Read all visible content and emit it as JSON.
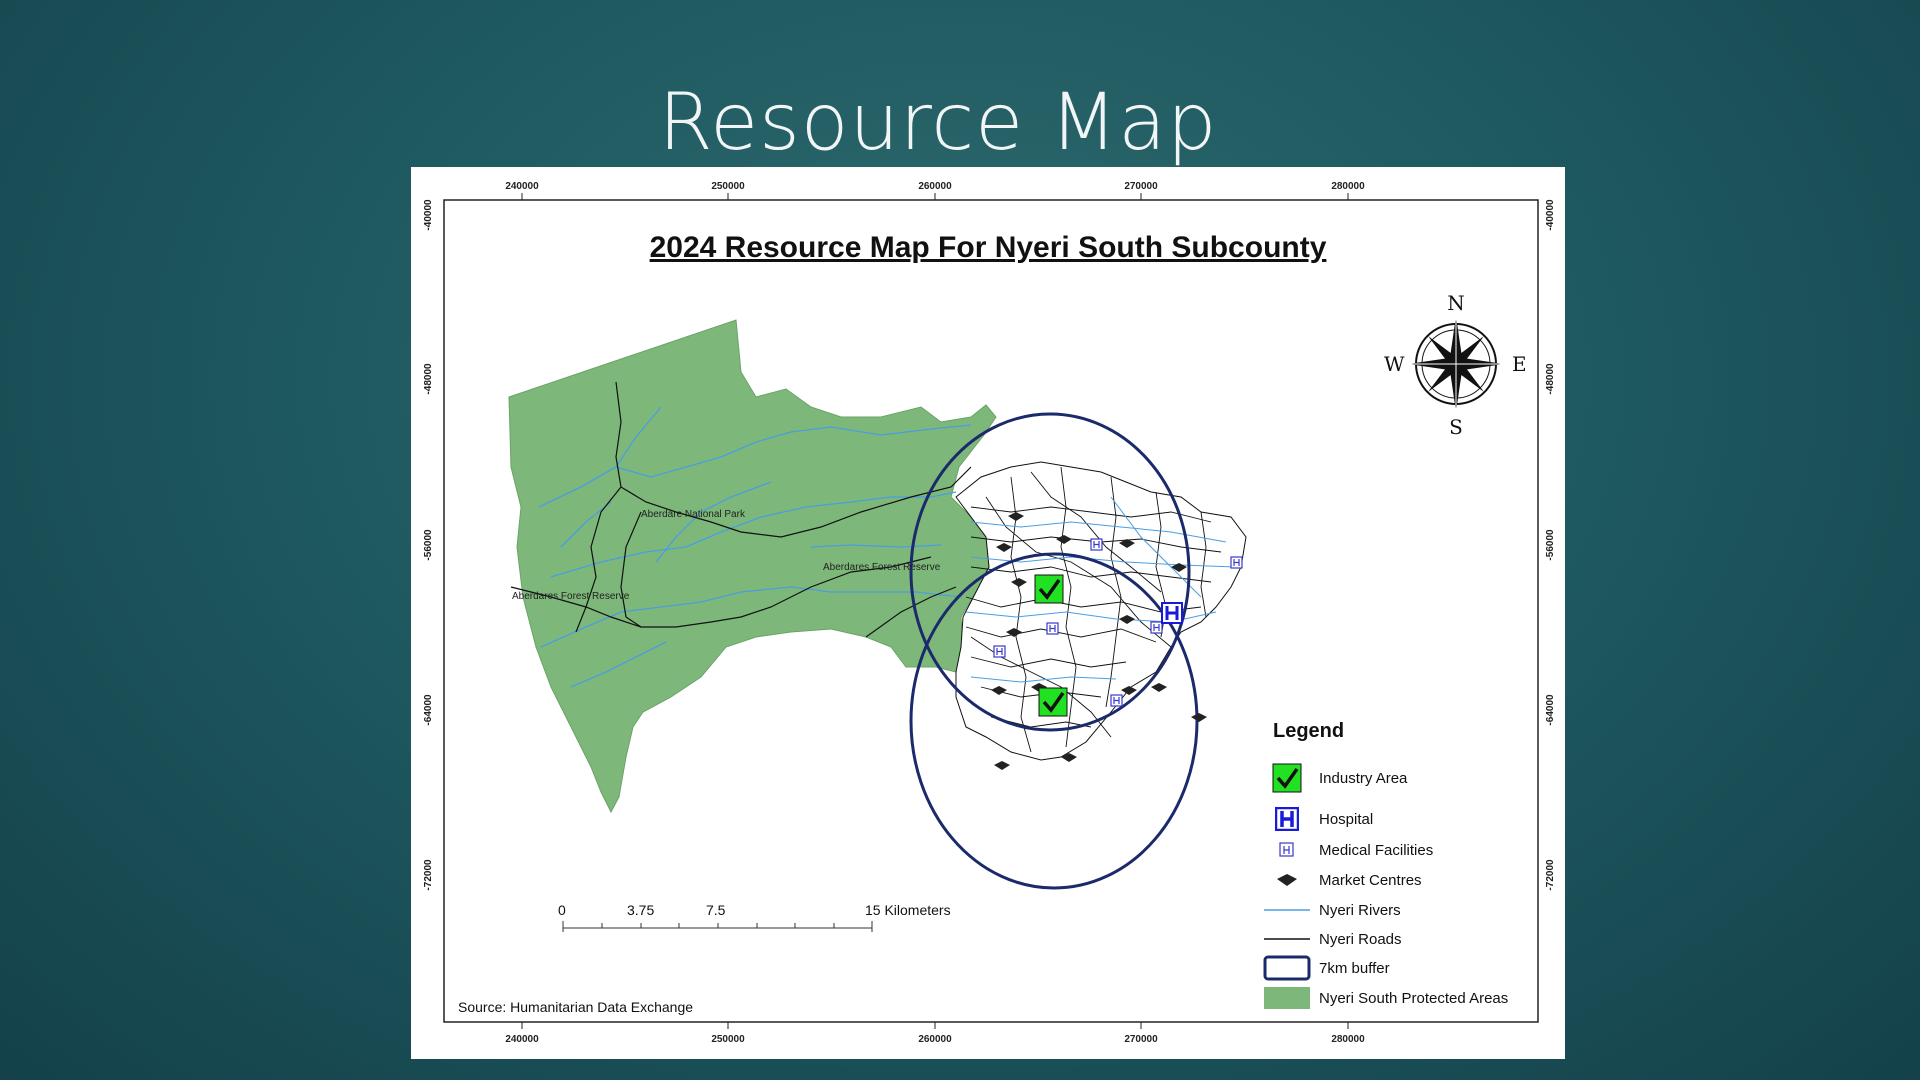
{
  "slide": {
    "title": "Resource Map"
  },
  "map": {
    "title": "2024 Resource Map For Nyeri South Subcounty",
    "x_ticks": [
      "240000",
      "250000",
      "260000",
      "270000",
      "280000"
    ],
    "y_ticks": [
      "-40000",
      "-48000",
      "-56000",
      "-64000",
      "-72000"
    ],
    "place_labels": {
      "national_park": "Aberdare National Park",
      "forest_east": "Aberdares Forest Reserve",
      "forest_west": "Aberdares Forest Reserve"
    },
    "compass": {
      "n": "N",
      "s": "S",
      "e": "E",
      "w": "W"
    },
    "scale_bar": {
      "l0": "0",
      "l1": "3.75",
      "l2": "7.5",
      "l3": "15 Kilometers"
    },
    "source": "Source: Humanitarian Data Exchange",
    "legend": {
      "title": "Legend",
      "items": [
        {
          "label": "Industry Area",
          "icon": "industry-check-icon",
          "color": "#22e022"
        },
        {
          "label": "Hospital",
          "icon": "hospital-icon",
          "color": "#1a1adb"
        },
        {
          "label": "Medical Facilities",
          "icon": "medical-facility-icon",
          "color": "#3a3acc"
        },
        {
          "label": "Market Centres",
          "icon": "market-centre-icon",
          "color": "#222222"
        },
        {
          "label": "Nyeri Rivers",
          "icon": "river-line-icon",
          "color": "#4a9ee0"
        },
        {
          "label": "Nyeri Roads",
          "icon": "road-line-icon",
          "color": "#111111"
        },
        {
          "label": "7km buffer",
          "icon": "buffer-icon",
          "color": "#1b2a6b"
        },
        {
          "label": "Nyeri South Protected Areas",
          "icon": "protected-area-icon",
          "color": "#7db87a"
        }
      ]
    }
  }
}
